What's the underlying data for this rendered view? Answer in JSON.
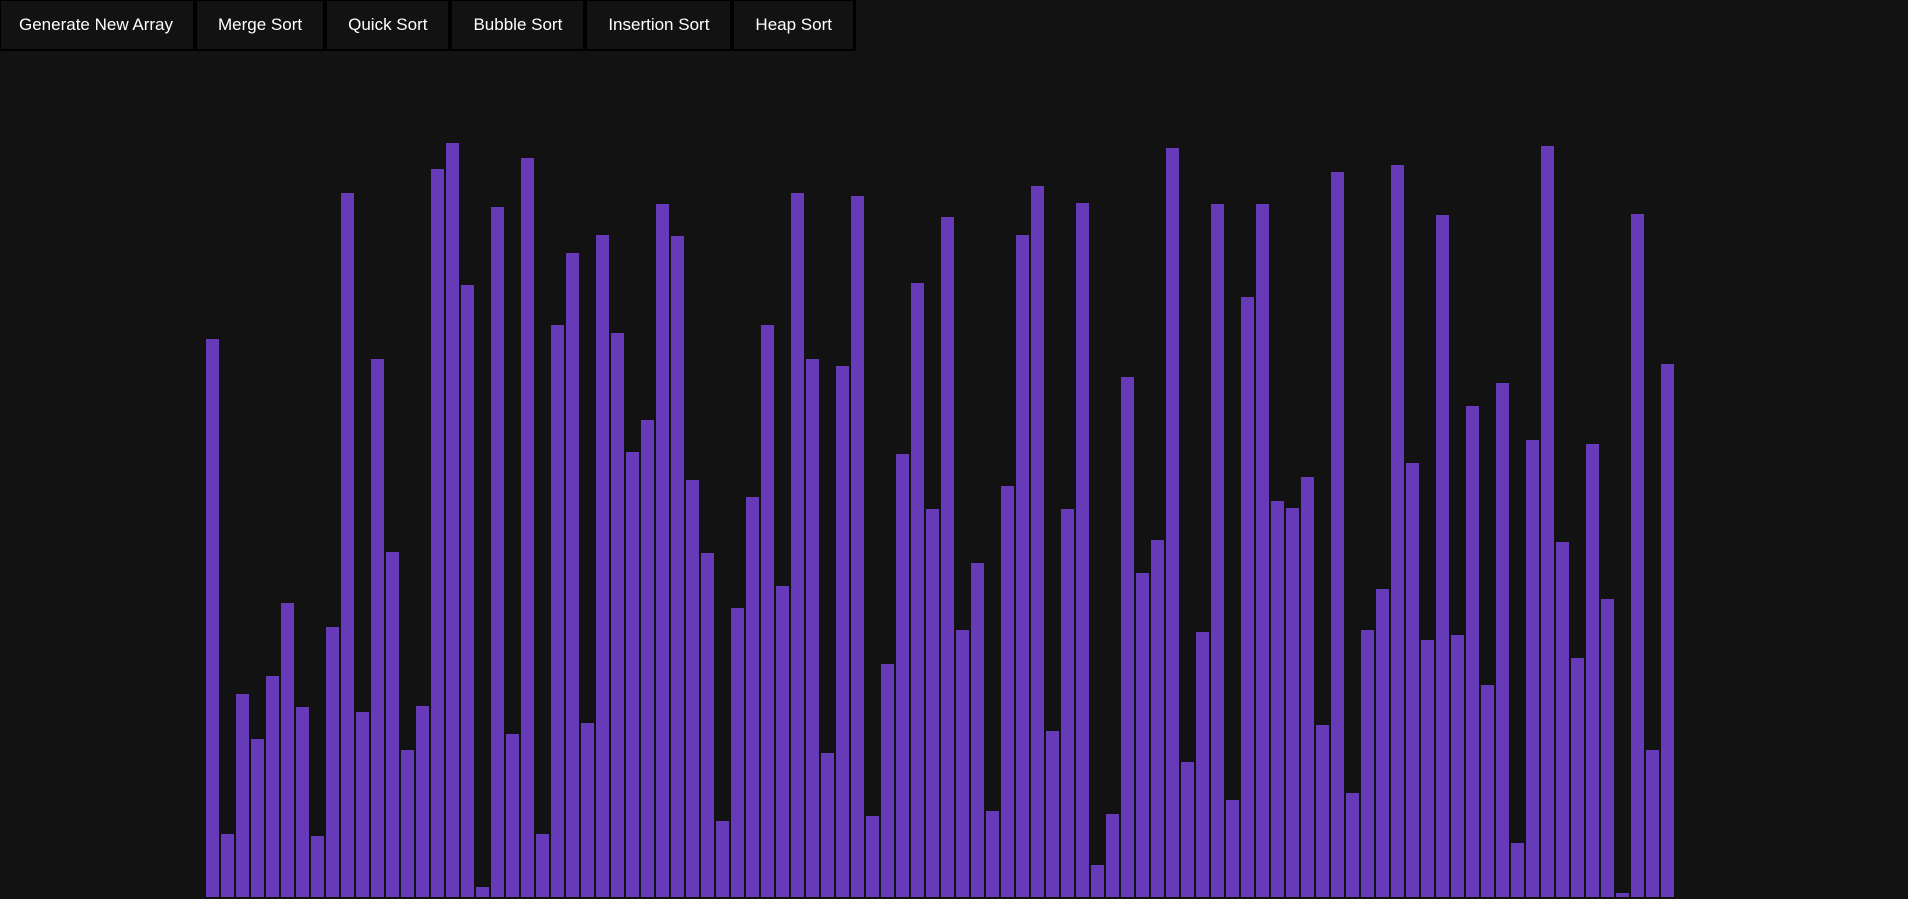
{
  "toolbar": {
    "buttons": [
      {
        "id": "generate",
        "label": "Generate New Array"
      },
      {
        "id": "merge",
        "label": "Merge Sort"
      },
      {
        "id": "quick",
        "label": "Quick Sort"
      },
      {
        "id": "bubble",
        "label": "Bubble Sort"
      },
      {
        "id": "insertion",
        "label": "Insertion Sort"
      },
      {
        "id": "heap",
        "label": "Heap Sort"
      }
    ]
  },
  "colors": {
    "background": "#121212",
    "bar": "#673ab7",
    "button_text": "#ffffff",
    "button_border": "#000000"
  },
  "array": {
    "values": [
      558,
      63,
      203,
      158,
      221,
      294,
      190,
      61,
      270,
      704,
      185,
      538,
      345,
      147,
      191,
      728,
      754,
      612,
      10,
      690,
      163,
      739,
      63,
      572,
      644,
      174,
      662,
      564,
      445,
      477,
      693,
      661,
      417,
      344,
      76,
      289,
      400,
      572,
      311,
      704,
      538,
      144,
      531,
      701,
      81,
      233,
      443,
      614,
      388,
      680,
      267,
      334,
      86,
      411,
      662,
      711,
      166,
      388,
      694,
      32,
      83,
      520,
      324,
      357,
      749,
      135,
      265,
      693,
      97,
      600,
      693,
      396,
      389,
      420,
      172,
      725,
      104,
      267,
      308,
      732,
      434,
      257,
      682,
      262,
      491,
      212,
      514,
      54,
      457,
      751,
      355,
      239,
      453,
      298,
      4,
      683,
      147,
      533
    ]
  }
}
